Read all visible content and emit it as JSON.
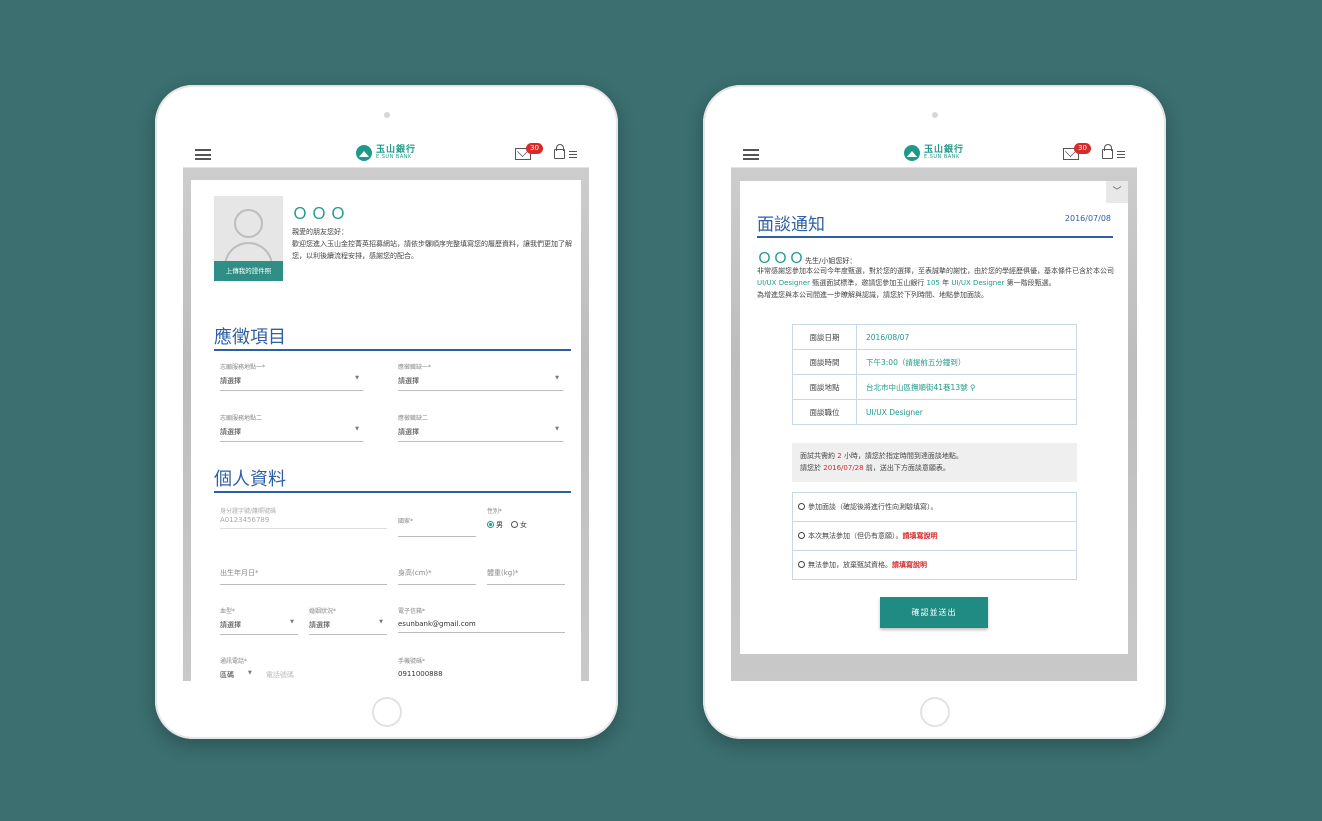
{
  "colors": {
    "background": "#3b6f70",
    "brand": "#1f9a8a",
    "heading_blue": "#2e5fa4",
    "alert_red": "#d62b2b"
  },
  "topbar": {
    "logo_cn": "玉山銀行",
    "logo_en": "E.SUN BANK",
    "mail_count": "30",
    "menu_icon": "hamburger-icon",
    "mail_icon": "mail-icon",
    "lock_icon": "lock-icon"
  },
  "left": {
    "upload_photo_label": "上傳我的證件照",
    "name": "ＯＯＯ",
    "greeting": "親愛的朋友您好：",
    "intro": "歡迎您進入玉山金控菁英招募網站，請依步驟順序完整填寫您的履歷資料，讓我們更加了解您，以利後續流程安排，感謝您的配合。",
    "section_apply": "應徵項目",
    "section_personal": "個人資料",
    "fields": {
      "location1_label": "志願服務地點一*",
      "location1_value": "請選擇",
      "position1_label": "應徵職缺一*",
      "position1_value": "請選擇",
      "location2_label": "志願服務地點二",
      "location2_value": "請選擇",
      "position2_label": "應徵職缺二",
      "position2_value": "請選擇",
      "id_label": "身分證字號/護照號碼",
      "id_value": "A0123456789",
      "country_label": "國家*",
      "gender_label": "性別*",
      "gender_male": "男",
      "gender_female": "女",
      "birth_label": "出生年月日*",
      "height_label": "身高(cm)*",
      "weight_label": "體重(kg)*",
      "blood_label": "血型*",
      "blood_value": "請選擇",
      "marital_label": "婚姻狀況*",
      "marital_value": "請選擇",
      "email_label": "電子信箱*",
      "email_value": "esunbank@gmail.com",
      "phone_label": "通訊電話*",
      "phone_area": "區碼",
      "phone_placeholder": "電話號碼",
      "mobile_label": "手機號碼*",
      "mobile_value": "0911000888"
    }
  },
  "right": {
    "title": "面談通知",
    "date": "2016/07/08",
    "name": "ＯＯＯ",
    "salutation": "先生/小姐您好：",
    "body_1": "非常感謝您參加本公司今年度甄選，對於您的選擇，至表誠摯的謝忱，由於您的學經歷俱優，基本條件已含於本公司",
    "body_hl_1": "UI/UX Designer",
    "body_2": "甄選面試標準，邀請您參加玉山銀行",
    "body_hl_2": "105",
    "body_3": "年",
    "body_hl_3": "UI/UX Designer",
    "body_4": "第一階段甄選。",
    "body_5": "為增進您與本公司間進一步瞭解與認識，請您於下列時間、地點參加面談。",
    "info": [
      {
        "key": "面談日期",
        "value": "2016/08/07"
      },
      {
        "key": "面談時間",
        "value": "下午3:00（請提前五分鐘到）"
      },
      {
        "key": "面談地點",
        "value": "台北市中山區撫順街41巷13號"
      },
      {
        "key": "面談職位",
        "value": "UI/UX Designer"
      }
    ],
    "note_1a": "面試共需約",
    "note_1_hours": "2",
    "note_1b": "小時，請您於指定時間到達面談地點。",
    "note_2a": "請您於",
    "note_2_date": "2016/07/28",
    "note_2b": "前，送出下方面談意願表。",
    "options": [
      {
        "text": "參加面談（確認後將進行性向測驗填寫）。",
        "note": ""
      },
      {
        "text": "本次無法參加（但仍有意願）。",
        "note": "請填寫說明"
      },
      {
        "text": "無法參加，放棄甄試資格。",
        "note": "請填寫說明"
      }
    ],
    "submit_label": "確認並送出"
  }
}
